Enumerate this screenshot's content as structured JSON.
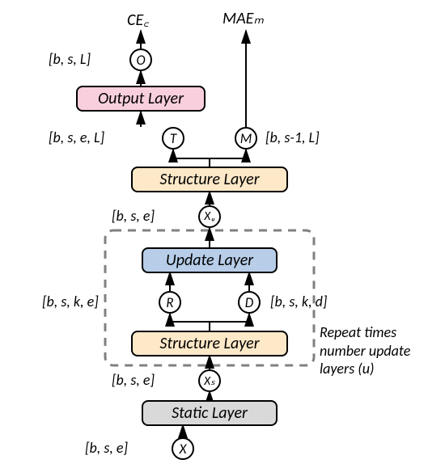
{
  "top_labels": {
    "ce_c": "CE꜀",
    "mae_m": "MAEₘ"
  },
  "shape_labels": {
    "o": "[b, s, L]",
    "t": "[b, s, e, L]",
    "m": "[b, s-1, L]",
    "xu": "[b, s, e]",
    "r": "[b, s, k, e]",
    "d": "[b, s, k, d]",
    "xs": "[b, s, e]",
    "x": "[b, s, e]"
  },
  "nodes": {
    "o": "O",
    "t": "T",
    "m": "M",
    "xu": "Xᵤ",
    "r": "R",
    "d": "D",
    "xs": "Xₛ",
    "x": "X"
  },
  "layers": {
    "output": "Output Layer",
    "structure1": "Structure Layer",
    "update": "Update Layer",
    "structure2": "Structure Layer",
    "static": "Static Layer"
  },
  "side_note": {
    "line1": "Repeat times",
    "line2": "number update",
    "line3": "layers (u)"
  }
}
